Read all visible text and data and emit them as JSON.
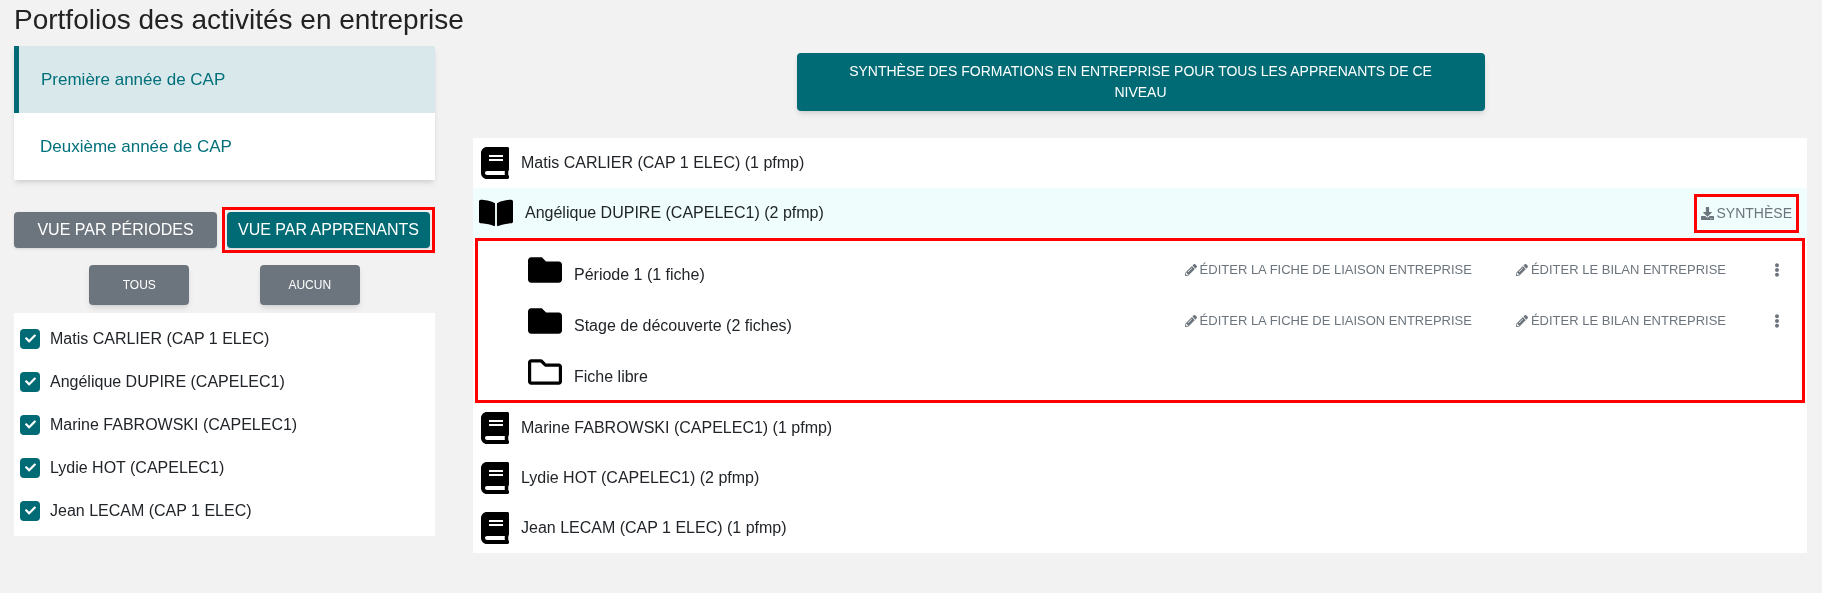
{
  "title": "Portfolios des activités en entreprise",
  "levels": [
    {
      "label": "Première année de CAP",
      "selected": true
    },
    {
      "label": "Deuxième année de CAP",
      "selected": false
    }
  ],
  "view_toggle": [
    {
      "label": "VUE PAR PÉRIODES",
      "selected": false,
      "highlighted": false
    },
    {
      "label": "VUE PAR APPRENANTS",
      "selected": true,
      "highlighted": true
    }
  ],
  "select_buttons": [
    "TOUS",
    "AUCUN"
  ],
  "learner_checklist": [
    {
      "label": "Matis CARLIER (CAP 1 ELEC)",
      "checked": true
    },
    {
      "label": "Angélique DUPIRE (CAPELEC1)",
      "checked": true
    },
    {
      "label": "Marine FABROWSKI (CAPELEC1)",
      "checked": true
    },
    {
      "label": "Lydie HOT (CAPELEC1)",
      "checked": true
    },
    {
      "label": "Jean LECAM (CAP 1 ELEC)",
      "checked": true
    }
  ],
  "summary_button": "SYNTHÈSE DES FORMATIONS EN ENTREPRISE POUR TOUS LES APPRENANTS DE CE NIVEAU",
  "learners": [
    {
      "label": "Matis CARLIER (CAP 1 ELEC) (1 pfmp)",
      "expanded": false
    },
    {
      "label": "Angélique DUPIRE (CAPELEC1) (2 pfmp)",
      "expanded": true,
      "synthese": {
        "label": "SYNTHÈSE",
        "highlighted": true
      },
      "children_highlighted": true,
      "children": [
        {
          "label": "Période 1 (1 fiche)",
          "has_fiches": true,
          "actions": [
            "ÉDITER LA FICHE DE LIAISON ENTREPRISE",
            "ÉDITER LE BILAN ENTREPRISE"
          ]
        },
        {
          "label": "Stage de découverte (2 fiches)",
          "has_fiches": true,
          "actions": [
            "ÉDITER LA FICHE DE LIAISON ENTREPRISE",
            "ÉDITER LE BILAN ENTREPRISE"
          ]
        },
        {
          "label": "Fiche libre",
          "has_fiches": false
        }
      ]
    },
    {
      "label": "Marine FABROWSKI (CAPELEC1) (1 pfmp)",
      "expanded": false
    },
    {
      "label": "Lydie HOT (CAPELEC1) (2 pfmp)",
      "expanded": false
    },
    {
      "label": "Jean LECAM (CAP 1 ELEC) (1 pfmp)",
      "expanded": false
    }
  ]
}
